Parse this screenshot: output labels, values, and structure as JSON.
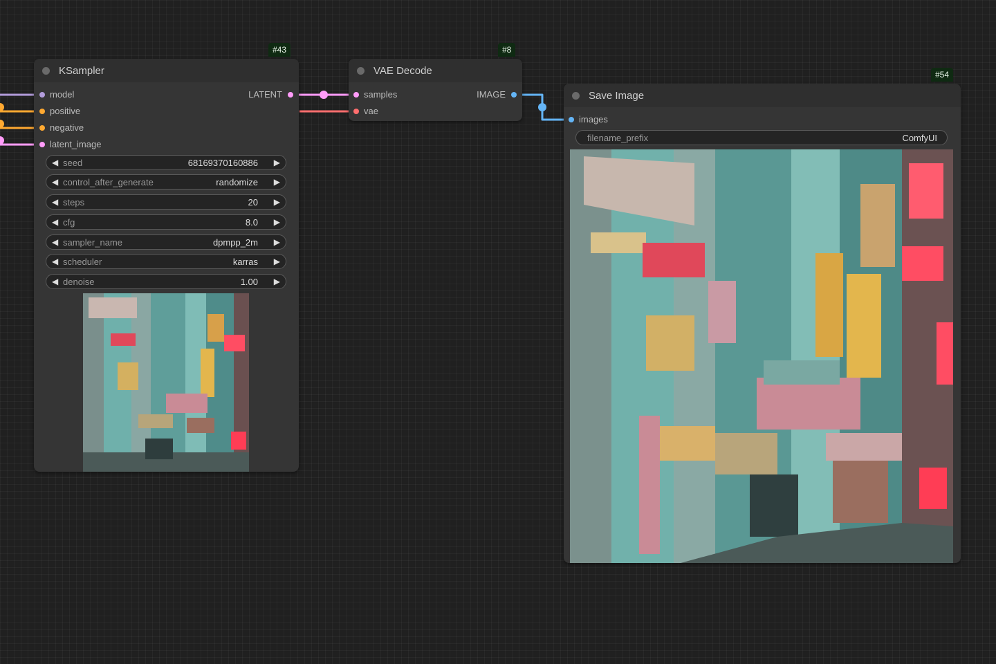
{
  "nodes": {
    "ksampler": {
      "id": "#43",
      "title": "KSampler",
      "inputs": [
        "model",
        "positive",
        "negative",
        "latent_image"
      ],
      "output": "LATENT",
      "widgets": [
        {
          "label": "seed",
          "value": "68169370160886"
        },
        {
          "label": "control_after_generate",
          "value": "randomize"
        },
        {
          "label": "steps",
          "value": "20"
        },
        {
          "label": "cfg",
          "value": "8.0"
        },
        {
          "label": "sampler_name",
          "value": "dpmpp_2m"
        },
        {
          "label": "scheduler",
          "value": "karras"
        },
        {
          "label": "denoise",
          "value": "1.00"
        }
      ],
      "preview_icon": "generated-image-preview"
    },
    "vae_decode": {
      "id": "#8",
      "title": "VAE Decode",
      "inputs": [
        "samples",
        "vae"
      ],
      "output": "IMAGE"
    },
    "save_image": {
      "id": "#54",
      "title": "Save Image",
      "inputs": [
        "images"
      ],
      "widgets": [
        {
          "label": "filename_prefix",
          "value": "ComfyUI"
        }
      ],
      "preview_icon": "generated-image-preview"
    }
  },
  "colors": {
    "model": "#b39ddb",
    "conditioning": "#ffa931",
    "latent": "#ff9cf9",
    "vae": "#ff6e6e",
    "image": "#64b5f6",
    "canvas": "#202020",
    "node_body": "#353535",
    "id_badge": "#0f2a12"
  }
}
